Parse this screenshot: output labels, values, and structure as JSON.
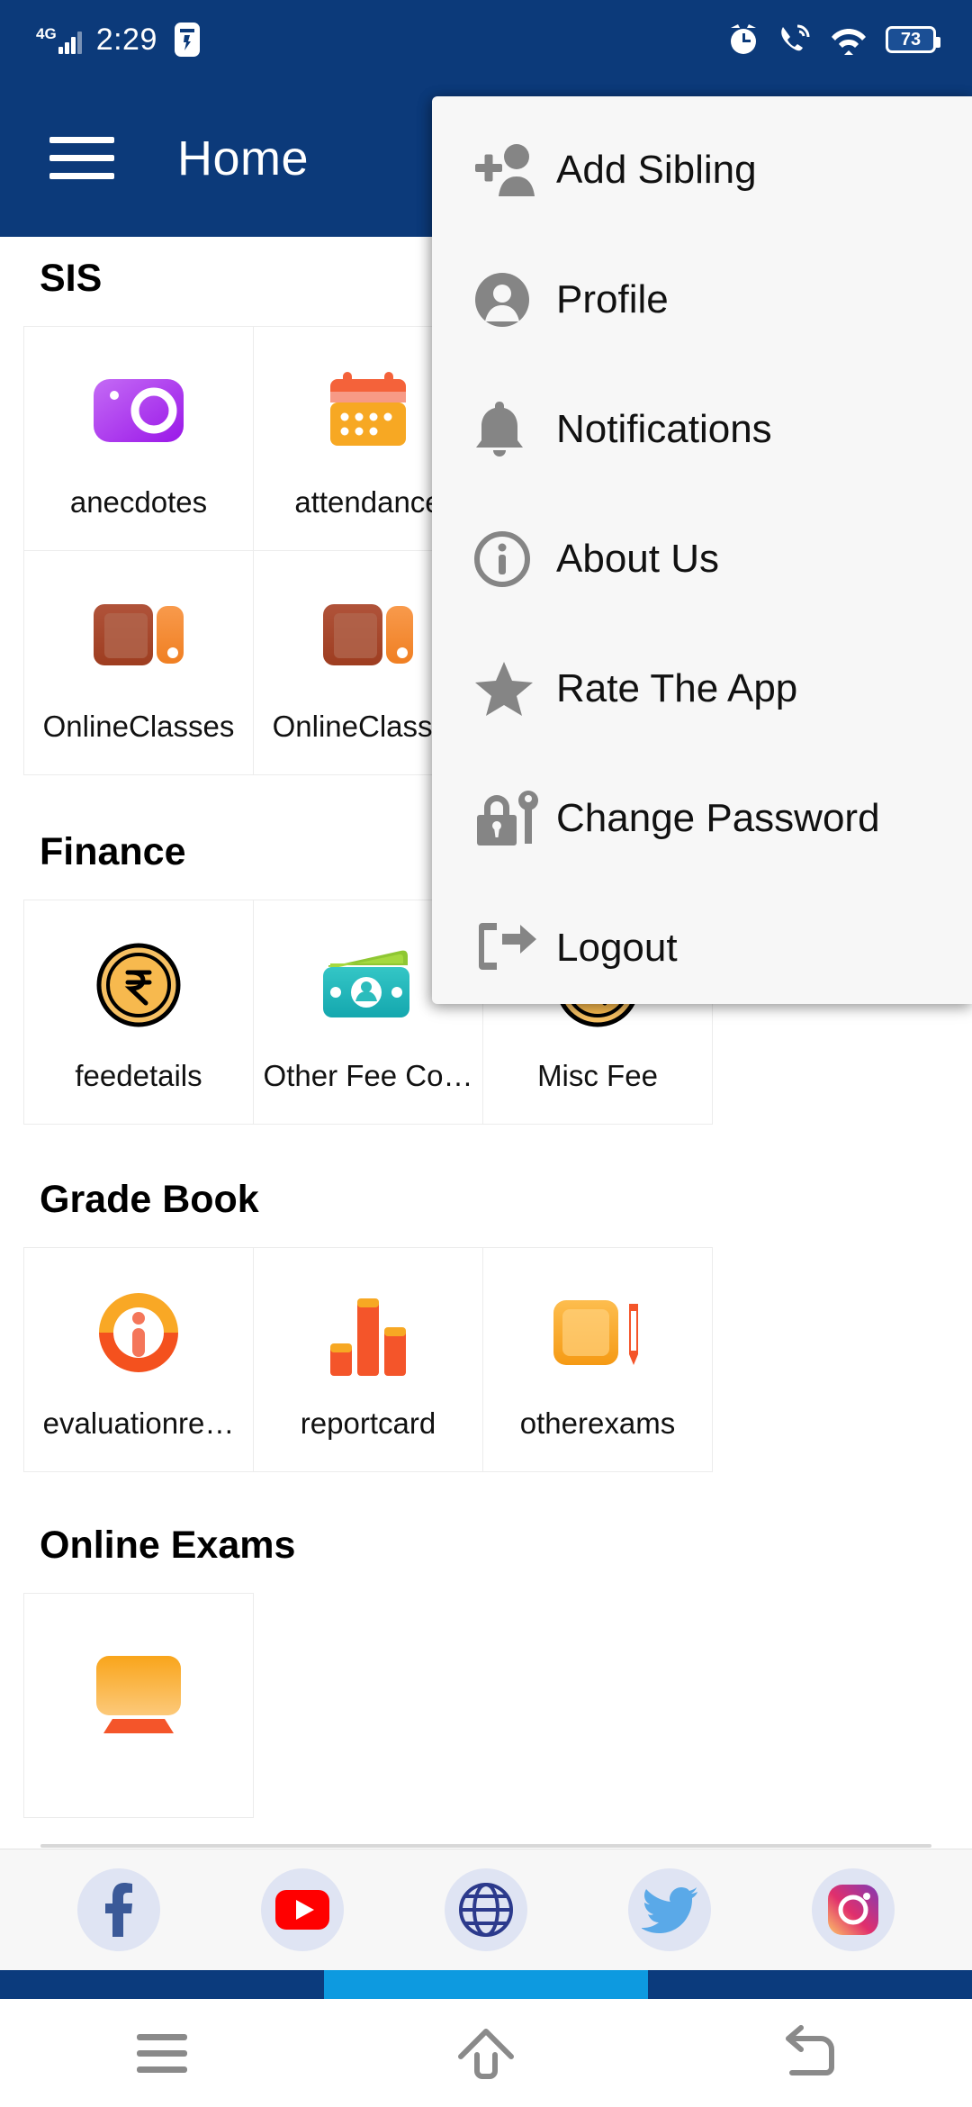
{
  "statusbar": {
    "network": "4G",
    "time": "2:29",
    "battery": "73",
    "icons": [
      "signal-bars-icon",
      "flashlight-icon",
      "alarm-clock-icon",
      "missed-call-icon",
      "wifi-icon",
      "battery-icon"
    ]
  },
  "appbar": {
    "title": "Home",
    "menu_icon": "hamburger-menu-icon"
  },
  "menu": {
    "items": [
      {
        "label": "Add Sibling",
        "icon": "add-person-icon"
      },
      {
        "label": "Profile",
        "icon": "profile-icon"
      },
      {
        "label": "Notifications",
        "icon": "bell-icon"
      },
      {
        "label": "About Us",
        "icon": "info-circle-icon"
      },
      {
        "label": "Rate The App",
        "icon": "star-icon"
      },
      {
        "label": "Change Password",
        "icon": "lock-key-icon"
      },
      {
        "label": "Logout",
        "icon": "logout-icon"
      }
    ]
  },
  "sections": [
    {
      "title": "SIS",
      "tiles": [
        {
          "label": "anecdotes",
          "icon": "camera-icon"
        },
        {
          "label": "attendance",
          "icon": "calendar-icon"
        },
        {
          "label": "OnlineClasses",
          "icon": "book-icon"
        },
        {
          "label": "OnlineClasses",
          "icon": "book-icon"
        }
      ]
    },
    {
      "title": "Finance",
      "tiles": [
        {
          "label": "feedetails",
          "icon": "rupee-coin-icon"
        },
        {
          "label": "Other Fee Co…",
          "icon": "money-wallet-icon"
        },
        {
          "label": "Misc Fee",
          "icon": "rupee-coin-icon"
        }
      ]
    },
    {
      "title": "Grade Book",
      "tiles": [
        {
          "label": "evaluationre…",
          "icon": "orange-info-icon"
        },
        {
          "label": "reportcard",
          "icon": "bar-chart-icon"
        },
        {
          "label": "otherexams",
          "icon": "note-pencil-icon"
        }
      ]
    },
    {
      "title": "Online Exams",
      "tiles": [
        {
          "label": "",
          "icon": "monitor-icon"
        }
      ]
    }
  ],
  "social": {
    "items": [
      {
        "name": "facebook-icon"
      },
      {
        "name": "youtube-icon"
      },
      {
        "name": "website-globe-icon"
      },
      {
        "name": "twitter-icon"
      },
      {
        "name": "instagram-icon"
      }
    ]
  },
  "navbar": {
    "items": [
      {
        "name": "recents-button"
      },
      {
        "name": "home-button"
      },
      {
        "name": "back-button"
      }
    ]
  },
  "colors": {
    "appbar_blue": "#0c3a7a",
    "strip_dark": "#0b3b7d",
    "strip_light": "#0d9ae0",
    "menu_bg": "#f7f7f7",
    "tile_border": "#ececec",
    "icon_gray": "#858585"
  }
}
